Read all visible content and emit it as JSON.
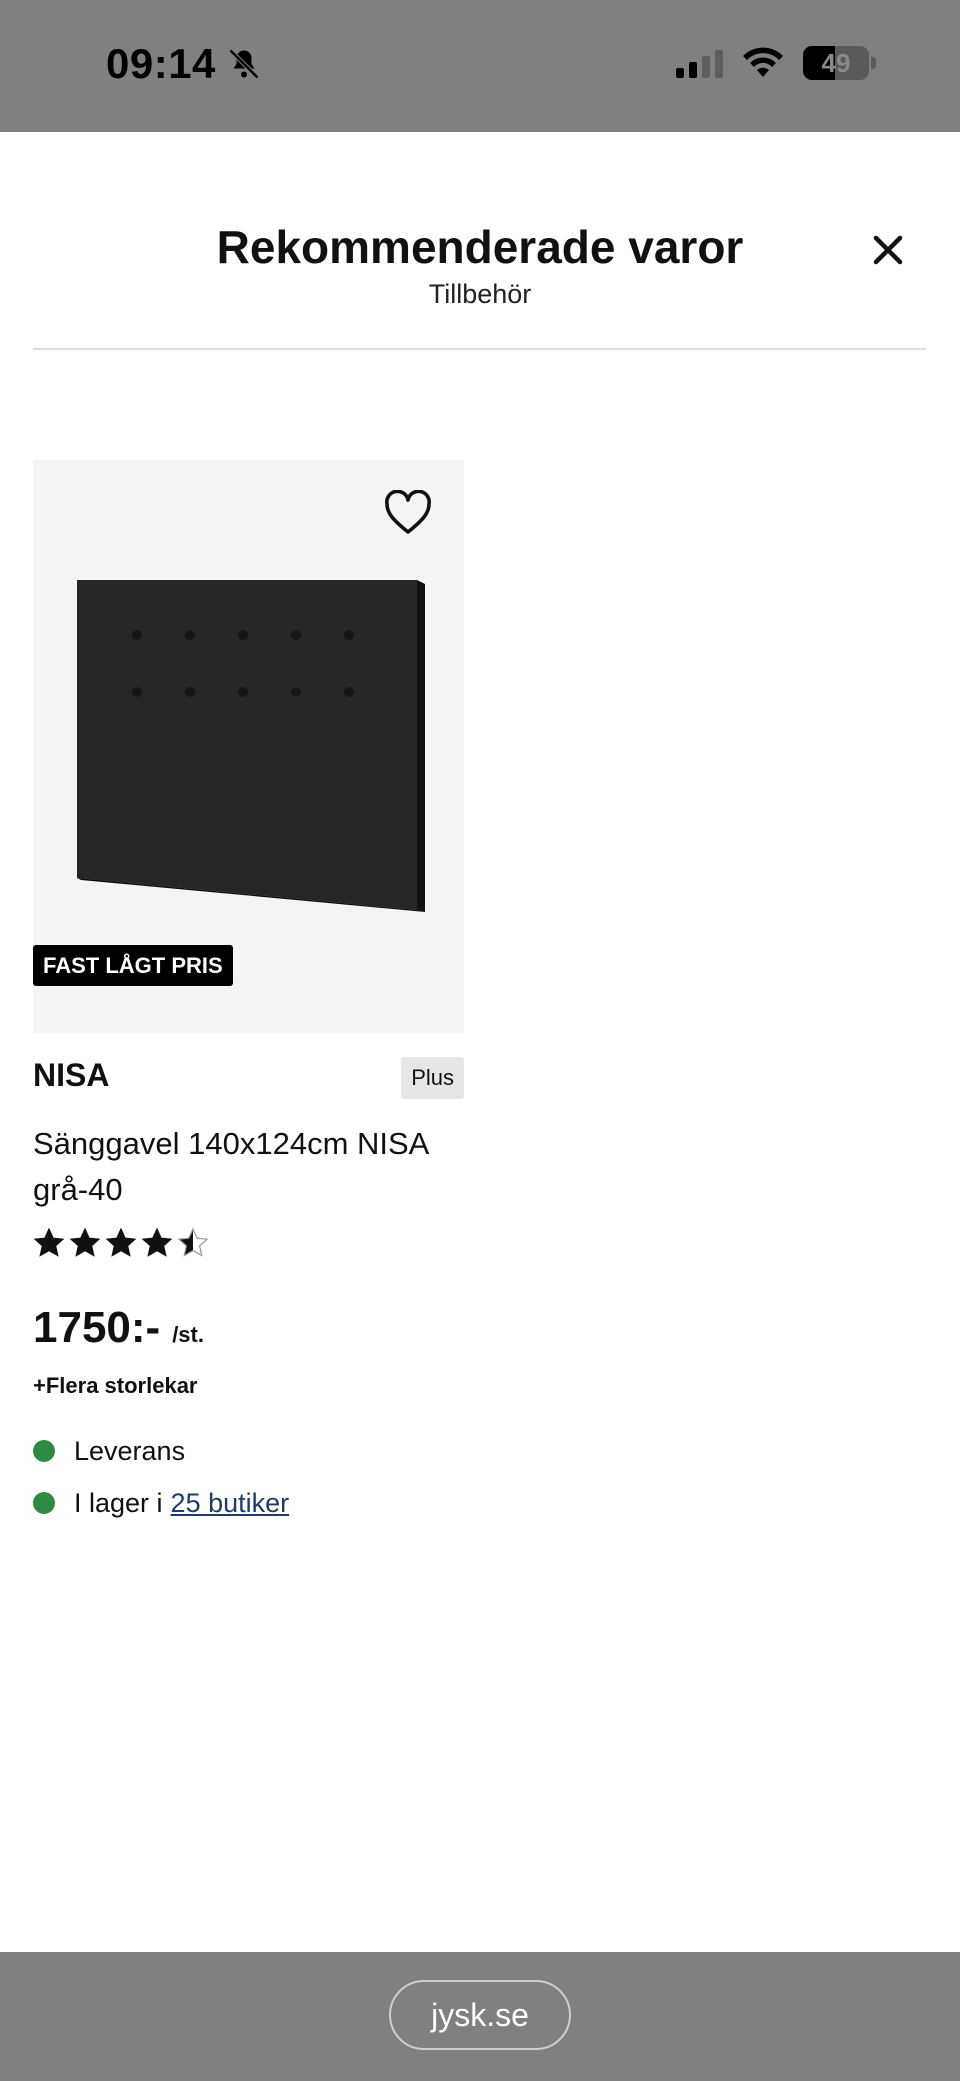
{
  "status_bar": {
    "time": "09:14",
    "battery": "49",
    "battery_level": 0.49
  },
  "header": {
    "title": "Rekommenderade varor",
    "subtitle": "Tillbehör"
  },
  "product": {
    "badge": "FAST LÅGT PRIS",
    "brand": "NISA",
    "tag": "Plus",
    "name": "Sänggavel 140x124cm NISA grå-40",
    "rating": 4.5,
    "rating_max": 5,
    "price": "1750:-",
    "unit": "/st.",
    "sizes_link": "+Flera storlekar",
    "availability": {
      "delivery": "Leverans",
      "stock_prefix": "I lager i",
      "stock_link": "25 butiker"
    }
  },
  "browser": {
    "url": "jysk.se"
  },
  "colors": {
    "available": "#2e8a40",
    "link": "#1f3a6e",
    "badge_bg": "#000000"
  },
  "icons": [
    "bell-slash-icon",
    "signal-icon",
    "wifi-icon",
    "battery-icon",
    "close-icon",
    "heart-icon",
    "star-icon"
  ]
}
